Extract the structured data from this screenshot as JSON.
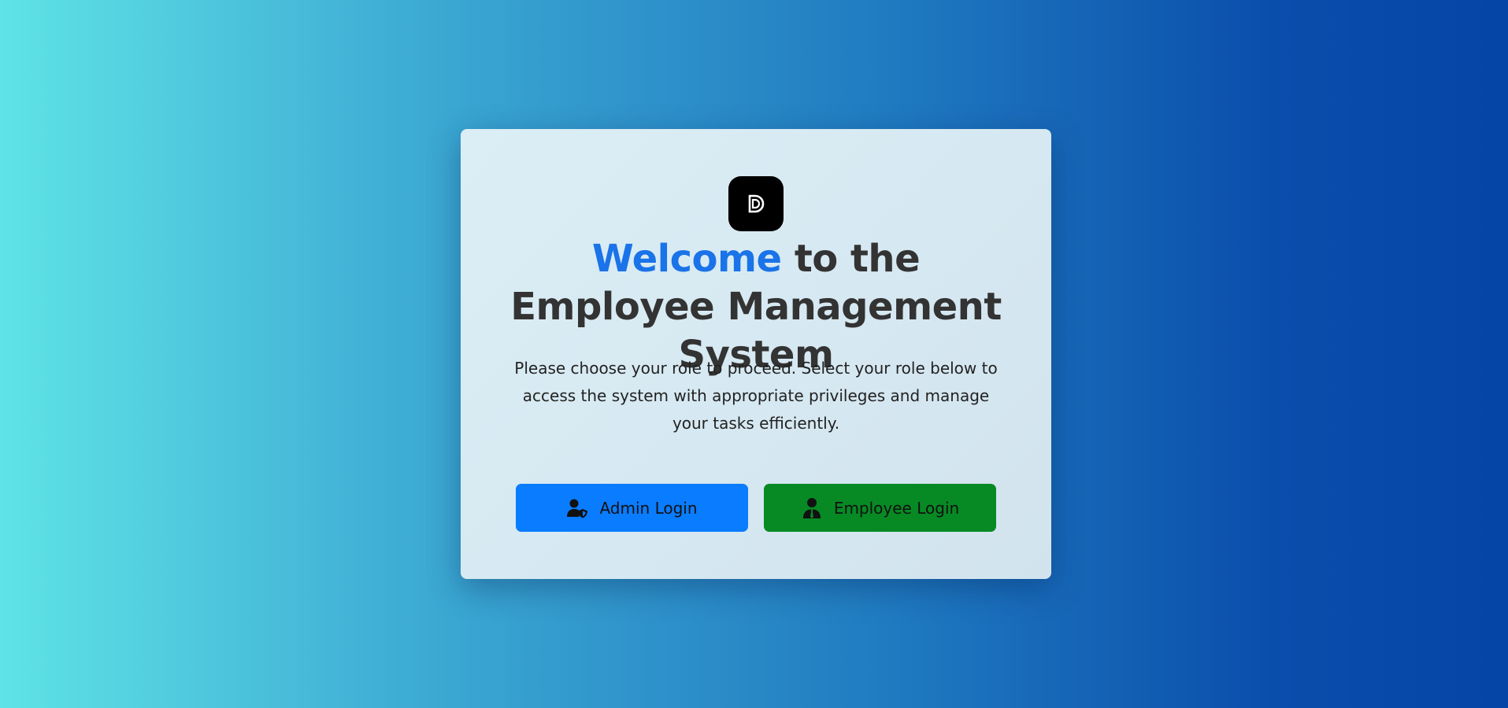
{
  "colors": {
    "accent": "#1a73e8",
    "admin_button": "#0a7cff",
    "employee_button": "#078a24",
    "title_text": "#333333"
  },
  "card": {
    "logo_icon": "d-logo-icon",
    "title_highlight": "Welcome",
    "title_rest": " to the Employee Management System",
    "description": "Please choose your role to proceed. Select your role below to access the system with appropriate privileges and manage your tasks efficiently.",
    "admin_button": {
      "label": "Admin Login",
      "icon": "user-shield-icon"
    },
    "employee_button": {
      "label": "Employee Login",
      "icon": "user-tie-icon"
    }
  }
}
